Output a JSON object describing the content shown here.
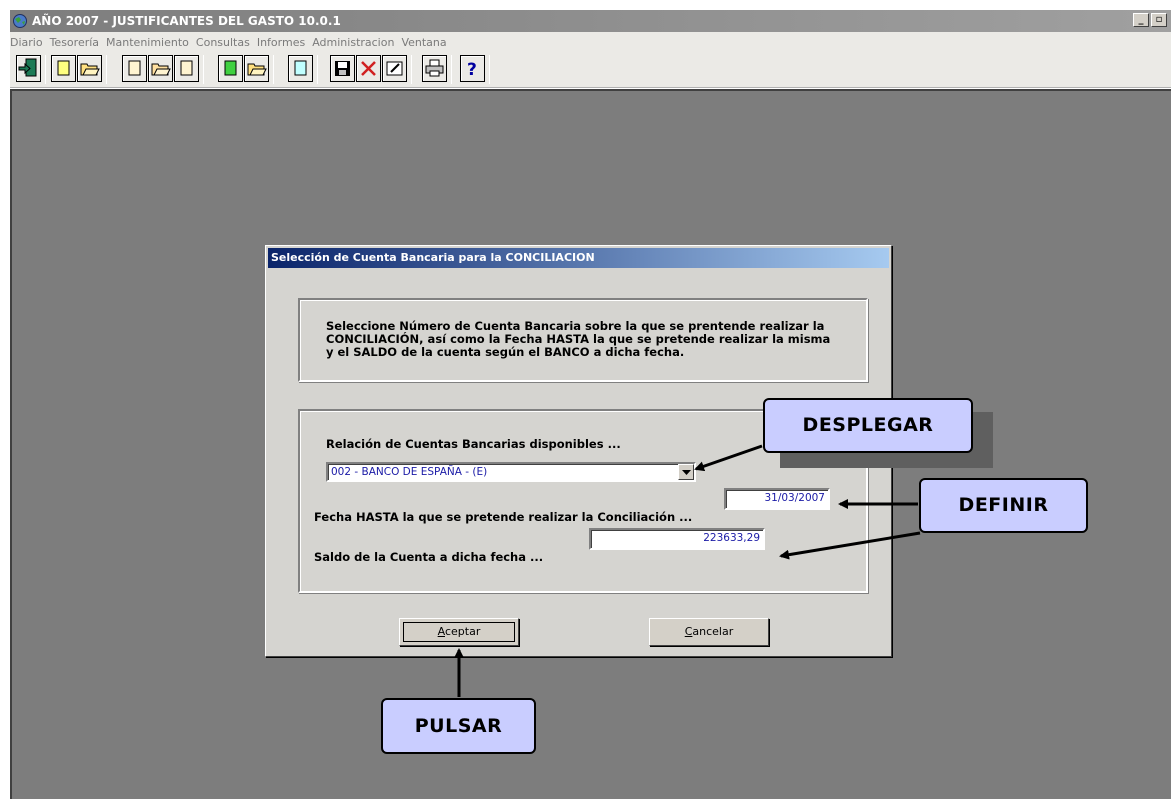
{
  "window": {
    "title": "AÑO 2007 - JUSTIFICANTES DEL GASTO 10.0.1"
  },
  "menu": [
    "Diario",
    "Tesorería",
    "Mantenimiento",
    "Consultas",
    "Informes",
    "Administracion",
    "Ventana"
  ],
  "toolbar_icons": [
    "exit-icon",
    "new-document-icon",
    "open-folder-icon",
    "new-document-icon",
    "open-folder-icon",
    "document-icon",
    "new-document-green-icon",
    "open-folder-icon",
    "document-icon",
    "save-icon",
    "delete-icon",
    "edit-icon",
    "print-icon",
    "help-icon"
  ],
  "dialog": {
    "title": "Selección de Cuenta Bancaria para la CONCILIACION",
    "description": "Seleccione Número de Cuenta Bancaria sobre la que se prentende realizar la\nCONCILIACIÓN, así como la Fecha HASTA la que se pretende realizar la misma\ny el SALDO de la cuenta según el BANCO a dicha fecha.",
    "accounts_label": "Relación de Cuentas Bancarias disponibles ...",
    "account_selected": "002 - BANCO DE ESPAÑA - (E)",
    "date_label": "Fecha HASTA la que se pretende realizar la Conciliación ...",
    "date_value": "31/03/2007",
    "balance_label": "Saldo de la Cuenta a dicha fecha ...",
    "balance_value": "223633,29",
    "accept_label": "Aceptar",
    "cancel_label": "Cancelar"
  },
  "callouts": {
    "desplegar": "DESPLEGAR",
    "definir": "DEFINIR",
    "pulsar": "PULSAR"
  },
  "colors": {
    "callout_fill": "#c9cdff",
    "title_gradient_start": "#0a246a",
    "title_gradient_end": "#a6caf0",
    "workspace": "#7d7d7d",
    "field_text": "#1a1aa6"
  }
}
